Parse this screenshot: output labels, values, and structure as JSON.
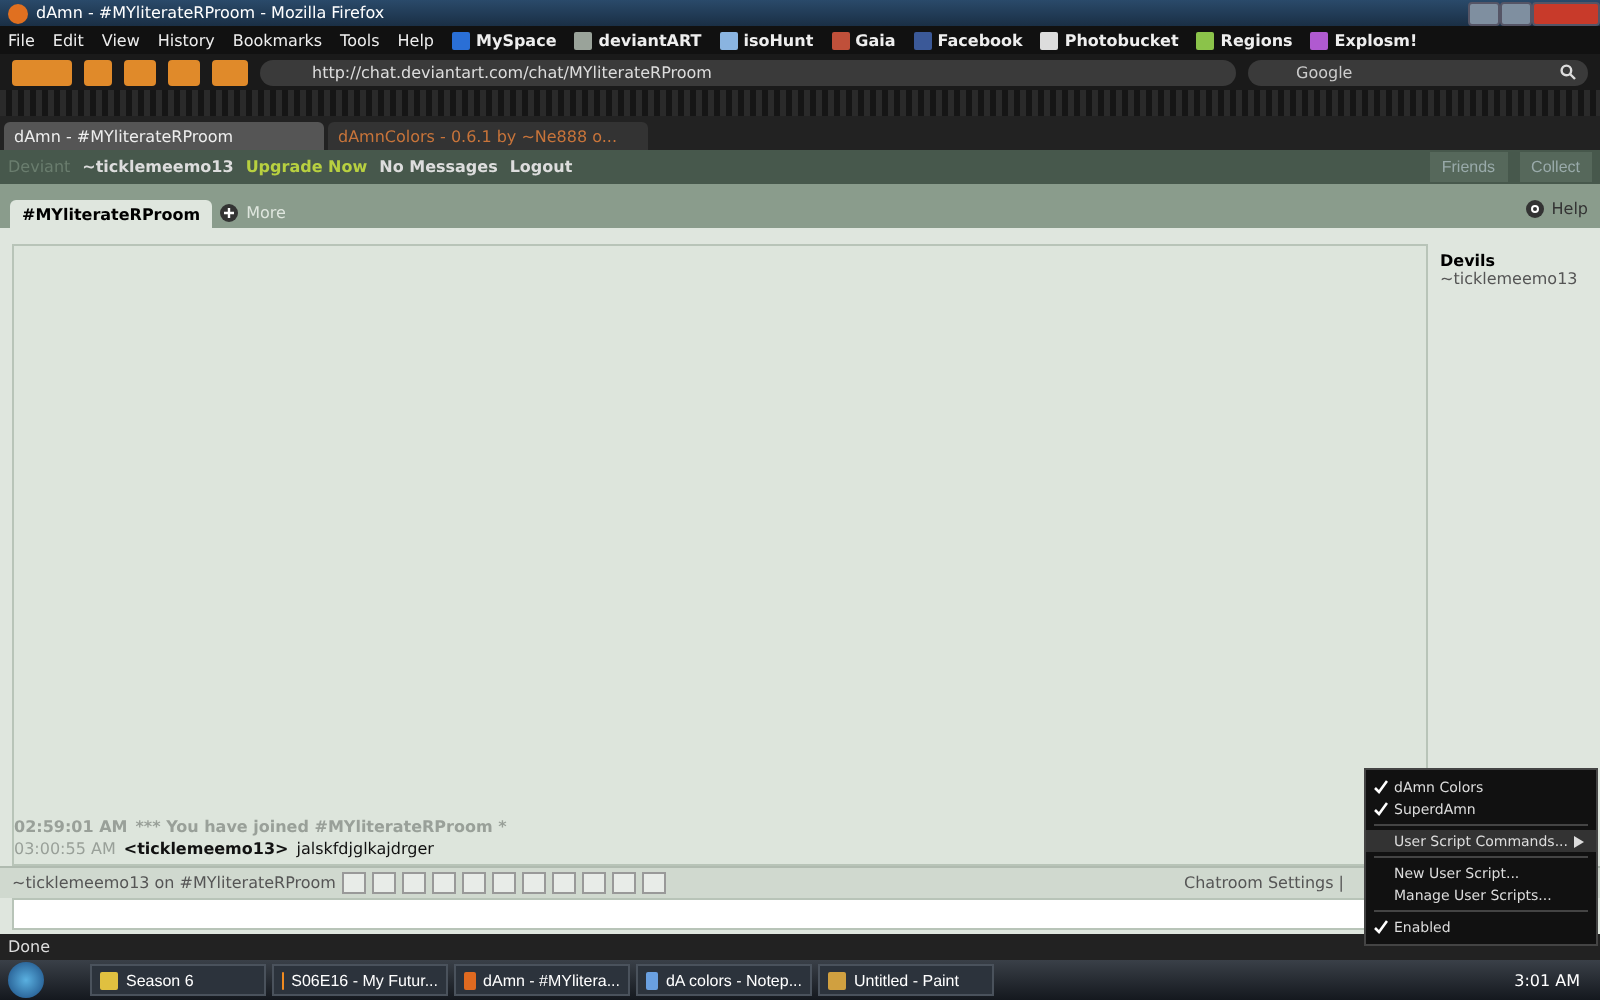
{
  "window": {
    "title": "dAmn - #MYliterateRProom - Mozilla Firefox"
  },
  "menu": [
    "File",
    "Edit",
    "View",
    "History",
    "Bookmarks",
    "Tools",
    "Help"
  ],
  "bookmarks": [
    {
      "label": "MySpace",
      "color": "#2a6fd6"
    },
    {
      "label": "deviantART",
      "color": "#9aa39a"
    },
    {
      "label": "isoHunt",
      "color": "#8ab4e0"
    },
    {
      "label": "Gaia",
      "color": "#c0503a"
    },
    {
      "label": "Facebook",
      "color": "#3b5998"
    },
    {
      "label": "Photobucket",
      "color": "#dddddd"
    },
    {
      "label": "Regions",
      "color": "#8bc34a"
    },
    {
      "label": "Explosm!",
      "color": "#b05ad0"
    }
  ],
  "address": {
    "value": "http://chat.deviantart.com/chat/MYliterateRProom"
  },
  "search": {
    "placeholder": "Google"
  },
  "browser_tabs": [
    {
      "label": "dAmn - #MYliterateRProom",
      "selected": true
    },
    {
      "label": "dAmnColors - 0.6.1 by ~Ne888 o...",
      "selected": false
    }
  ],
  "da_bar": {
    "deviant_label": "Deviant",
    "username": "~ticklemeemo13",
    "links": [
      "Upgrade Now",
      "No Messages",
      "Logout"
    ],
    "friends": "Friends",
    "collect": "Collect"
  },
  "chat_tabs": [
    {
      "label": "#MYliterateRProom",
      "selected": true
    }
  ],
  "more": "More",
  "help": "Help",
  "messages": [
    {
      "kind": "system",
      "time": "02:59:01 AM",
      "text": "*** You have joined #MYliterateRProom *"
    },
    {
      "kind": "user",
      "time": "03:00:55 AM",
      "user": "<ticklemeemo13>",
      "text": "jalskfdjglkajdrger"
    }
  ],
  "members": {
    "group": "Devils",
    "users": [
      "~ticklemeemo13"
    ]
  },
  "input_bar": {
    "label": "~ticklemeemo13 on #MYliterateRProom",
    "settings": "Chatroom Settings |"
  },
  "status": "Done",
  "popup_menu": [
    {
      "kind": "check",
      "label": "dAmn Colors",
      "checked": true
    },
    {
      "kind": "check",
      "label": "SuperdAmn",
      "checked": true
    },
    {
      "kind": "sep"
    },
    {
      "kind": "submenu",
      "label": "User Script Commands...",
      "selected": true
    },
    {
      "kind": "sep"
    },
    {
      "kind": "item",
      "label": "New User Script..."
    },
    {
      "kind": "item",
      "label": "Manage User Scripts..."
    },
    {
      "kind": "sep"
    },
    {
      "kind": "check",
      "label": "Enabled",
      "checked": true
    }
  ],
  "taskbar": [
    {
      "label": "Season 6",
      "color": "#e0c040"
    },
    {
      "label": "S06E16 - My Futur...",
      "color": "#f08a20"
    },
    {
      "label": "dAmn - #MYlitera...",
      "color": "#e06a20"
    },
    {
      "label": "dA colors - Notep...",
      "color": "#6aa0e0"
    },
    {
      "label": "Untitled - Paint",
      "color": "#d0a040"
    }
  ],
  "clock": "3:01 AM"
}
